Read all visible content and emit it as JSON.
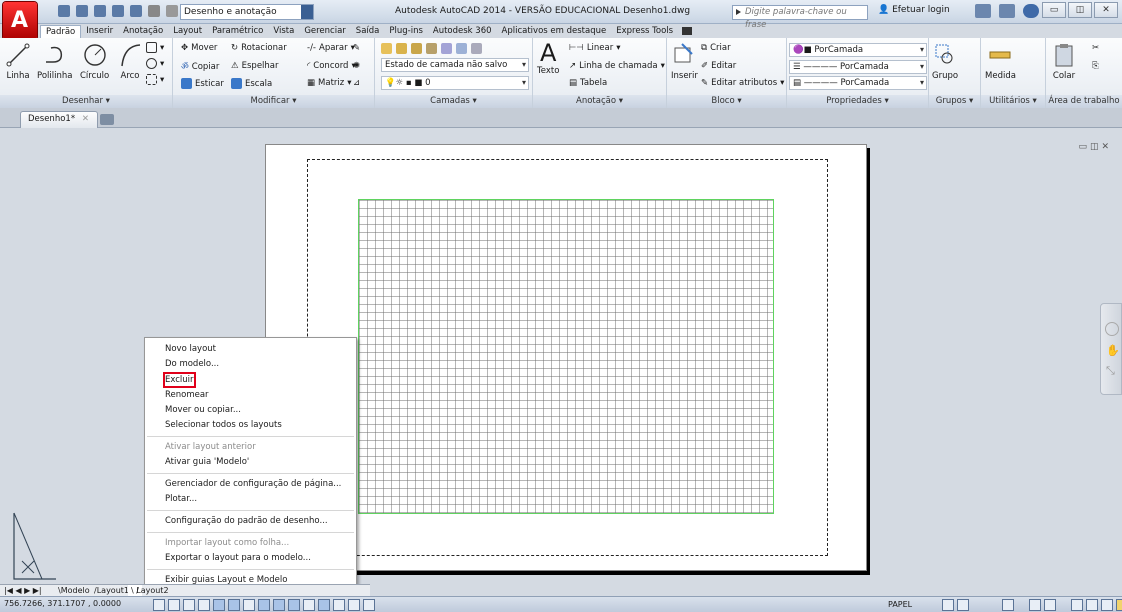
{
  "window": {
    "workspace": "Desenho e anotação",
    "title": "Autodesk AutoCAD 2014 - VERSÃO EDUCACIONAL   Desenho1.dwg",
    "search_placeholder": "Digite palavra-chave ou frase",
    "login": "Efetuar login"
  },
  "ribbon_tabs": [
    "Padrão",
    "Inserir",
    "Anotação",
    "Layout",
    "Paramétrico",
    "Vista",
    "Gerenciar",
    "Saída",
    "Plug-ins",
    "Autodesk 360",
    "Aplicativos em destaque",
    "Express Tools"
  ],
  "panels": {
    "desenhar": {
      "title": "Desenhar ▾",
      "linha": "Linha",
      "polilinha": "Polilinha",
      "circulo": "Círculo",
      "arco": "Arco"
    },
    "modificar": {
      "title": "Modificar ▾",
      "mover": "Mover",
      "rotacionar": "Rotacionar",
      "aparar": "Aparar",
      "copiar": "Copiar",
      "espelhar": "Espelhar",
      "concord": "Concord",
      "esticar": "Esticar",
      "escala": "Escala",
      "matriz": "Matriz"
    },
    "camadas": {
      "title": "Camadas ▾",
      "estado": "Estado de camada não salvo",
      "layer": "0"
    },
    "anotacao": {
      "title": "Anotação ▾",
      "texto": "Texto",
      "linear": "Linear",
      "linha_chamada": "Linha de chamada",
      "tabela": "Tabela"
    },
    "bloco": {
      "title": "Bloco ▾",
      "inserir": "Inserir",
      "criar": "Criar",
      "editar": "Editar",
      "editar_atributos": "Editar atributos"
    },
    "propriedades": {
      "title": "Propriedades ▾",
      "cor": "PorCamada",
      "tipo_linha": "PorCamada",
      "espessura": "PorCamada"
    },
    "grupos": {
      "title": "Grupos ▾",
      "grupo": "Grupo"
    },
    "utilitarios": {
      "title": "Utilitários ▾",
      "medida": "Medida"
    },
    "area_trabalho": {
      "title": "Área de trabalho",
      "colar": "Colar"
    }
  },
  "file_tab": {
    "label": "Desenho1*"
  },
  "context_menu": {
    "items": [
      "Novo layout",
      "Do modelo...",
      "Excluir",
      "Renomear",
      "Mover ou copiar...",
      "Selecionar todos os layouts"
    ],
    "items2": [
      "Ativar layout anterior",
      "Ativar guia 'Modelo'"
    ],
    "items3": [
      "Gerenciador de configuração de página...",
      "Plotar..."
    ],
    "items4": [
      "Configuração do padrão de desenho..."
    ],
    "items5": [
      "Importar layout como folha...",
      "Exportar o layout para o modelo..."
    ],
    "items6": [
      "Exibir guias Layout e Modelo"
    ]
  },
  "layout_tabs": {
    "nav": "|◀ ◀ ▶ ▶|",
    "modelo": "Modelo",
    "layout1": "Layout1",
    "layout2": "Layout2"
  },
  "status": {
    "coords": "756.7266, 371.1707 , 0.0000",
    "papel": "PAPEL"
  }
}
